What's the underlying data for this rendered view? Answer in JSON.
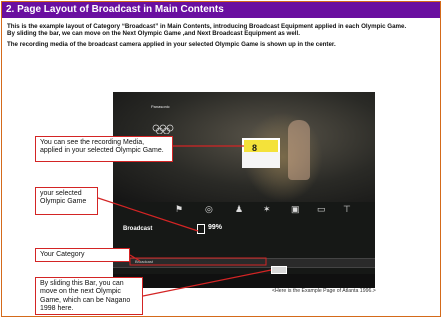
{
  "header": {
    "title": "2. Page Layout of Broadcast in Main Contents"
  },
  "intro": {
    "line1": "This is the example layout of Category “Broadcast” in Main Contents, introducing Broadcast Equipment applied in each Olympic Game.",
    "line2": "By sliding the bar, we can move on the Next Olympic Game ,and Next Broadcast Equipment as well.",
    "line3": "The recording media of the broadcast camera applied in your selected Olympic Game is shown up in the center."
  },
  "screenshot": {
    "brand": "Panasonic",
    "media_number": "8",
    "broadcast_title": "Broadcast",
    "percent": "99%",
    "category_label": "Broadcast"
  },
  "callouts": {
    "media": "You can see the recording Media, applied in your selected Olympic Game.",
    "game": "your selected Olympic Game",
    "category": "Your Category",
    "slider": "By sliding this Bar, you can move on the next Olympic Game, which can be Nagano 1998 here."
  },
  "note": "<Here is the Example Page of Atlanta 1996.>",
  "colors": {
    "header_bg": "#6a0fa0",
    "frame_border": "#d46a1a",
    "callout_red": "#d32424"
  }
}
